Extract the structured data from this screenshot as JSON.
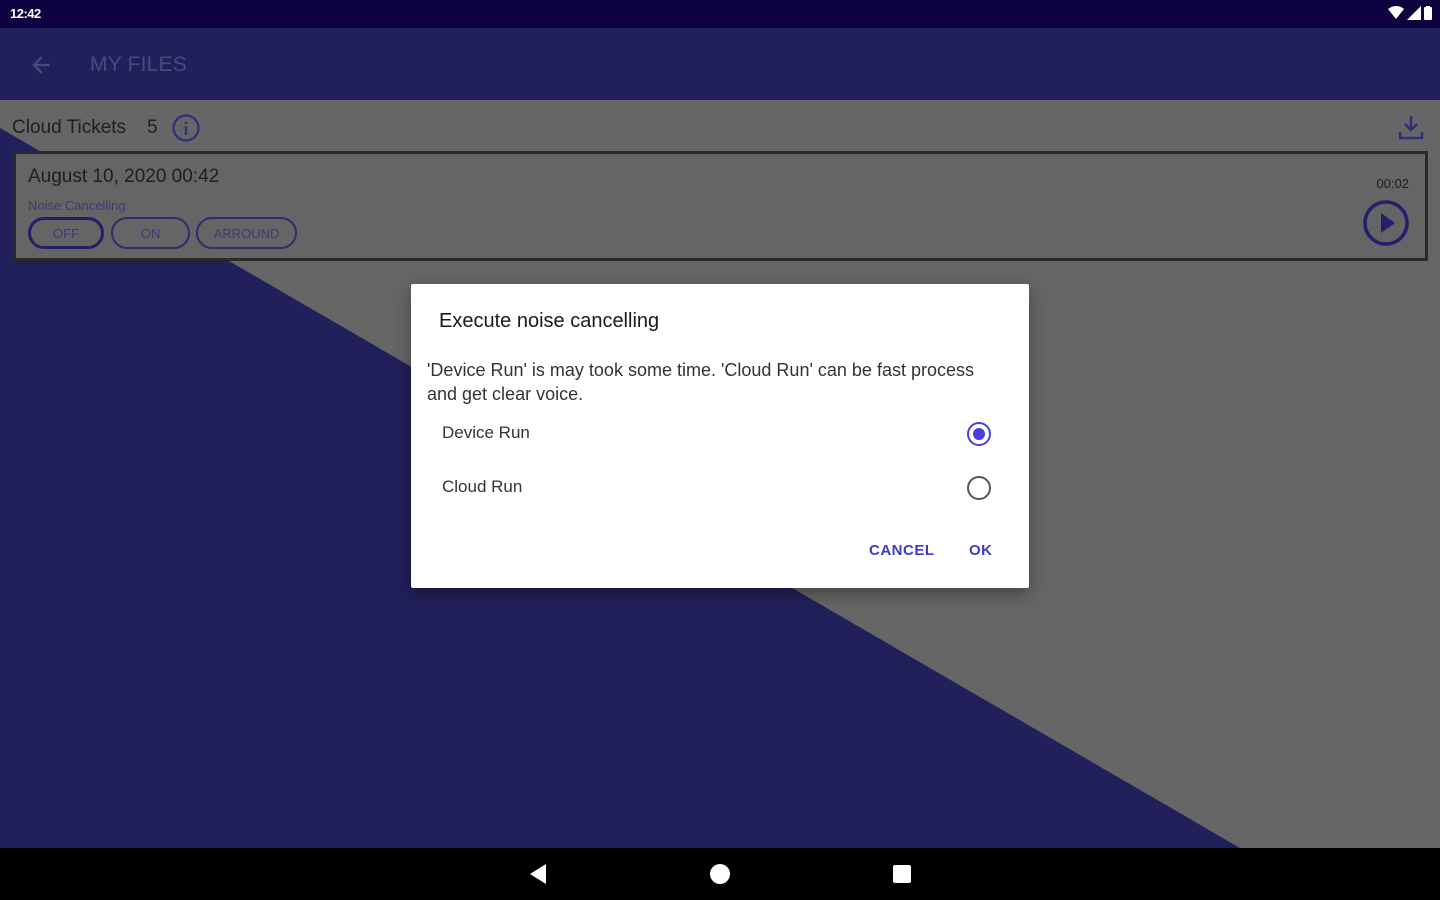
{
  "status_bar": {
    "time": "12:42"
  },
  "app_bar": {
    "title": "MY FILES"
  },
  "list_header": {
    "label": "Cloud Tickets",
    "count": "5"
  },
  "file_card": {
    "date": "August 10, 2020 00:42",
    "nc_label": "Noise Cancelling",
    "modes": [
      "OFF",
      "ON",
      "ARROUND"
    ],
    "selected_mode": "OFF",
    "duration": "00:02"
  },
  "dialog": {
    "title": "Execute noise cancelling",
    "message": "'Device Run' is may took some time. 'Cloud Run' can be fast process and get clear voice.",
    "options": [
      {
        "label": "Device Run",
        "checked": true
      },
      {
        "label": "Cloud Run",
        "checked": false
      }
    ],
    "cancel_label": "CANCEL",
    "ok_label": "OK"
  },
  "colors": {
    "primary": "#22205a",
    "status_bar": "#0e0340",
    "accent": "#4a3fe0",
    "scrim": "#666666"
  }
}
